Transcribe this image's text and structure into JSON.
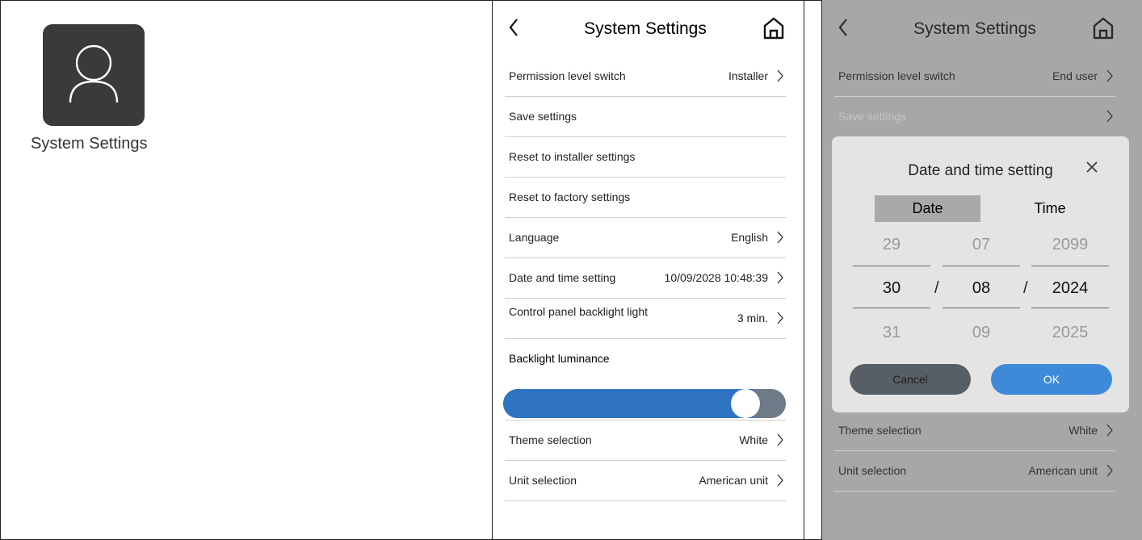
{
  "colors": {
    "tile_bg": "#3a3a3a",
    "slider_fill": "#2f74c0",
    "slider_track": "#6f7a88",
    "overlay_bg": "#a7a7a7",
    "dialog_bg": "#e4e4e4",
    "ok_button": "#3f8ad8",
    "cancel_button": "#585e65"
  },
  "icons": [
    "user-icon",
    "back-chevron-icon",
    "home-icon",
    "chevron-right-icon",
    "close-icon"
  ],
  "left": {
    "app_label": "System Settings"
  },
  "screen_a": {
    "title": "System Settings",
    "rows": [
      {
        "label": "Permission level switch",
        "value": "Installer"
      },
      {
        "label": "Save settings",
        "value": ""
      },
      {
        "label": "Reset to installer settings",
        "value": ""
      },
      {
        "label": "Reset to factory settings",
        "value": ""
      },
      {
        "label": "Language",
        "value": "English"
      },
      {
        "label": "Date and time setting",
        "value": "10/09/2028 10:48:39"
      },
      {
        "label": "Control panel backlight light",
        "value": "3 min."
      }
    ],
    "backlight": {
      "label": "Backlight luminance",
      "level_fraction": 0.87
    },
    "bottom_rows": [
      {
        "label": "Theme selection",
        "value": "White"
      },
      {
        "label": "Unit selection",
        "value": "American unit"
      }
    ]
  },
  "screen_b": {
    "title": "System Settings",
    "rows": [
      {
        "label": "Permission level switch",
        "value": "End user"
      },
      {
        "label": "Save settings",
        "value": ""
      }
    ],
    "bottom_rows": [
      {
        "label": "Theme selection",
        "value": "White"
      },
      {
        "label": "Unit selection",
        "value": "American unit"
      }
    ],
    "dialog": {
      "title": "Date and time setting",
      "tabs": {
        "date": "Date",
        "time": "Time",
        "selected": "date"
      },
      "wheels": {
        "day": [
          "29",
          "30",
          "31"
        ],
        "month": [
          "07",
          "08",
          "09"
        ],
        "year": [
          "2099",
          "2024",
          "2025"
        ]
      },
      "separator": "/",
      "cancel": "Cancel",
      "ok": "OK"
    }
  }
}
